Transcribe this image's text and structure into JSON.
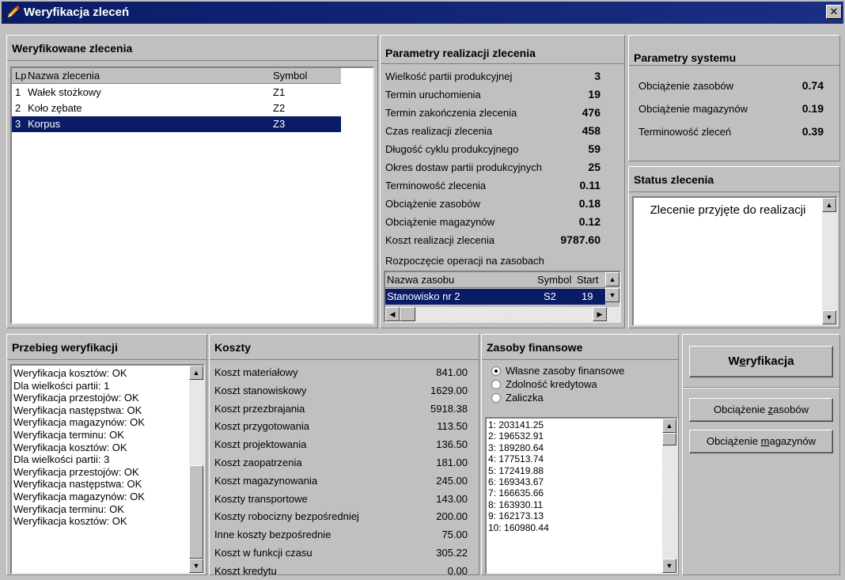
{
  "window": {
    "title": "Weryfikacja zleceń",
    "close_glyph": "✕"
  },
  "orders": {
    "title": "Weryfikowane zlecenia",
    "columns": {
      "lp": "Lp",
      "name": "Nazwa zlecenia",
      "symbol": "Symbol"
    },
    "rows": [
      {
        "lp": "1",
        "name": "Wałek stożkowy",
        "symbol": "Z1"
      },
      {
        "lp": "2",
        "name": "Koło zębate",
        "symbol": "Z2"
      },
      {
        "lp": "3",
        "name": "Korpus",
        "symbol": "Z3"
      }
    ],
    "selected_index": 2
  },
  "params": {
    "title": "Parametry realizacji zlecenia",
    "rows": [
      {
        "label": "Wielkość partii produkcyjnej",
        "value": "3"
      },
      {
        "label": "Termin uruchomienia",
        "value": "19"
      },
      {
        "label": "Termin zakończenia zlecenia",
        "value": "476"
      },
      {
        "label": "Czas realizacji zlecenia",
        "value": "458"
      },
      {
        "label": "Długość cyklu produkcyjnego",
        "value": "59"
      },
      {
        "label": "Okres dostaw partii produkcyjnych",
        "value": "25"
      },
      {
        "label": "Terminowość zlecenia",
        "value": "0.11"
      },
      {
        "label": "Obciążenie zasobów",
        "value": "0.18"
      },
      {
        "label": "Obciążenie magazynów",
        "value": "0.12"
      },
      {
        "label": "Koszt realizacji zlecenia",
        "value": "9787.60"
      }
    ],
    "ops_label": "Rozpoczęcie operacji na zasobach",
    "ops_columns": {
      "name": "Nazwa zasobu",
      "symbol": "Symbol",
      "start": "Start"
    },
    "ops_rows": [
      {
        "name": "Stanowisko nr 2",
        "symbol": "S2",
        "start": "19"
      }
    ]
  },
  "system": {
    "title": "Parametry systemu",
    "rows": [
      {
        "label": "Obciążenie zasobów",
        "value": "0.74"
      },
      {
        "label": "Obciążenie magazynów",
        "value": "0.19"
      },
      {
        "label": "Terminowość zleceń",
        "value": "0.39"
      }
    ]
  },
  "status": {
    "title": "Status zlecenia",
    "text": "Zlecenie przyjęte do realizacji"
  },
  "log": {
    "title": "Przebieg weryfikacji",
    "lines": [
      "Weryfikacja kosztów: OK",
      "Dla wielkości partii: 1",
      "Weryfikacja przestojów: OK",
      "Weryfikacja następstwa: OK",
      "Weryfikacja magazynów: OK",
      "Weryfikacja terminu: OK",
      "Weryfikacja kosztów: OK",
      "Dla wielkości partii: 3",
      "Weryfikacja przestojów: OK",
      "Weryfikacja następstwa: OK",
      "Weryfikacja magazynów: OK",
      "Weryfikacja terminu: OK",
      "Weryfikacja kosztów: OK"
    ]
  },
  "costs": {
    "title": "Koszty",
    "rows": [
      {
        "label": "Koszt materiałowy",
        "value": "841.00"
      },
      {
        "label": "Koszt stanowiskowy",
        "value": "1629.00"
      },
      {
        "label": "Koszt przezbrajania",
        "value": "5918.38"
      },
      {
        "label": "Koszt przygotowania",
        "value": "113.50"
      },
      {
        "label": "Koszt projektowania",
        "value": "136.50"
      },
      {
        "label": "Koszt zaopatrzenia",
        "value": "181.00"
      },
      {
        "label": "Koszt magazynowania",
        "value": "245.00"
      },
      {
        "label": "Koszty transportowe",
        "value": "143.00"
      },
      {
        "label": "Koszty robocizny bezpośredniej",
        "value": "200.00"
      },
      {
        "label": "Inne koszty bezpośrednie",
        "value": "75.00"
      },
      {
        "label": "Koszt w funkcji czasu",
        "value": "305.22"
      },
      {
        "label": "Koszt kredytu",
        "value": "0.00"
      }
    ]
  },
  "funds": {
    "title": "Zasoby finansowe",
    "options": [
      {
        "label": "Własne zasoby finansowe",
        "checked": true
      },
      {
        "label": "Zdolność kredytowa",
        "checked": false
      },
      {
        "label": "Zaliczka",
        "checked": false
      }
    ],
    "list": [
      "1: 203141.25",
      "2: 196532.91",
      "3: 189280.64",
      "4: 177513.74",
      "5: 172419.88",
      "6: 169343.67",
      "7: 166635.66",
      "8: 163930.11",
      "9: 162173.13",
      "10: 160980.44"
    ]
  },
  "actions": {
    "verify": {
      "pre": "W",
      "key": "e",
      "post": "ryfikacja"
    },
    "load_resources": {
      "pre": "Obciążenie ",
      "key": "z",
      "post": "asobów"
    },
    "load_warehouses": {
      "pre": "Obciążenie ",
      "key": "m",
      "post": "agazynów"
    }
  },
  "icons": {
    "app": "pencil-icon",
    "close": "close-icon",
    "up": "▲",
    "down": "▼",
    "left": "◀",
    "right": "▶"
  }
}
